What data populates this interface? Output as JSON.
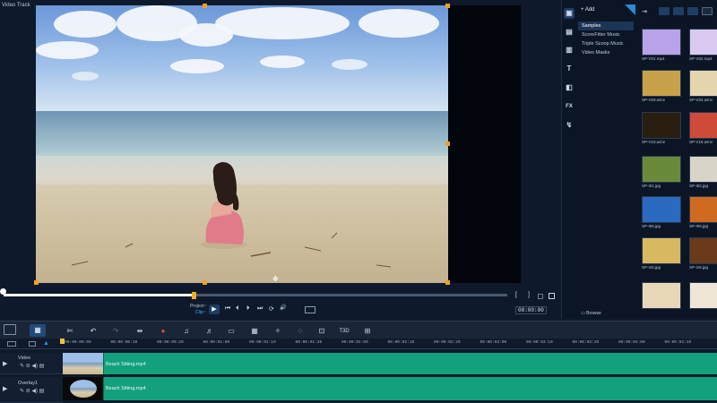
{
  "preview": {
    "track_label": "Video Track",
    "project_label": "Project~",
    "clip_label": "Clip~",
    "play_symbol": "▶",
    "timecode": "00:00:00"
  },
  "controls": {
    "skip_start": "⏮",
    "prev_frame": "⏴",
    "next_frame": "⏵",
    "skip_end": "⏭",
    "repeat": "⟳",
    "volume": "🔊",
    "mark_in": "[",
    "mark_out": "]"
  },
  "library": {
    "add_label": "Add",
    "folders": [
      "Samples",
      "ScoreFitter Music",
      "Triple Scoop Music",
      "Video Masks"
    ],
    "selected_folder": "Samples",
    "browse_label": "Browse",
    "side_icons": [
      "media-icon",
      "instant-project-icon",
      "title-icon",
      "transition-icon",
      "fx-icon",
      "path-icon"
    ],
    "fx_text": "FX",
    "title_text": "T",
    "thumbnails": [
      {
        "label": "SP-V01.mp4",
        "color": "#b9a3e8"
      },
      {
        "label": "SP-V02.mp4",
        "color": "#d9c9f0"
      },
      {
        "label": "SP-V03.wmv",
        "color": "#c8a24a"
      },
      {
        "label": "SP-V04.wmv",
        "color": "#e6d6b0"
      },
      {
        "label": "SP-V15.wmv",
        "color": "#2a1e10"
      },
      {
        "label": "SP-V16.wmv",
        "color": "#d04a3a"
      },
      {
        "label": "SP-I01.jpg",
        "color": "#6a8a3a"
      },
      {
        "label": "SP-I02.jpg",
        "color": "#d8d4c8"
      },
      {
        "label": "SP-I06.jpg",
        "color": "#2a6ac0"
      },
      {
        "label": "SP-I09.jpg",
        "color": "#d06a20"
      },
      {
        "label": "SP-I15.jpg",
        "color": "#d8b860"
      },
      {
        "label": "SP-I16.jpg",
        "color": "#6a3a1a"
      },
      {
        "label": "",
        "color": "#e8d8b8"
      },
      {
        "label": "",
        "color": "#f0e6d8"
      }
    ]
  },
  "toolbar": {
    "view_symbol": "▦"
  },
  "ruler": {
    "ticks": [
      "00:00:00:00",
      "00:00:00:10",
      "00:00:00:20",
      "00:00:01:00",
      "00:00:01:10",
      "00:00:01:20",
      "00:00:02:00",
      "00:00:02:10",
      "00:00:02:20",
      "00:00:03:00",
      "00:00:03:10",
      "00:00:03:20",
      "00:00:04:00",
      "00:00:04:10"
    ]
  },
  "tracks": [
    {
      "name": "Video",
      "clip": "Beach Sitting.mp4"
    },
    {
      "name": "Overlay1",
      "clip": "Beach Sitting.mp4"
    }
  ]
}
